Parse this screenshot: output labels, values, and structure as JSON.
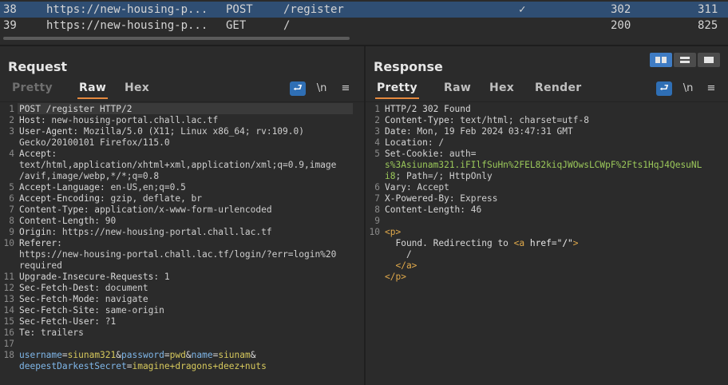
{
  "history": {
    "rows": [
      {
        "num": "38",
        "host": "https://new-housing-p...",
        "method": "POST",
        "path": "/register",
        "edited": "✓",
        "status": "302",
        "length": "311"
      },
      {
        "num": "39",
        "host": "https://new-housing-p...",
        "method": "GET",
        "path": "/",
        "edited": "",
        "status": "200",
        "length": "825"
      }
    ]
  },
  "request": {
    "title": "Request",
    "tabs": [
      "Pretty",
      "Raw",
      "Hex"
    ],
    "active_tab": "Raw",
    "wrap_icon": "⮐",
    "newline_toggle": "\\n",
    "menu_icon": "≡",
    "lines": [
      {
        "n": "1",
        "k": "POST /register HTTP/2",
        "v": ""
      },
      {
        "n": "2",
        "k": "Host",
        "v": ": new-housing-portal.chall.lac.tf"
      },
      {
        "n": "3",
        "k": "User-Agent",
        "v": ": Mozilla/5.0 (X11; Linux x86_64; rv:109.0)"
      },
      {
        "n": "",
        "k": "",
        "v": "Gecko/20100101 Firefox/115.0"
      },
      {
        "n": "4",
        "k": "Accept",
        "v": ":"
      },
      {
        "n": "",
        "k": "",
        "v": "text/html,application/xhtml+xml,application/xml;q=0.9,image"
      },
      {
        "n": "",
        "k": "",
        "v": "/avif,image/webp,*/*;q=0.8"
      },
      {
        "n": "5",
        "k": "Accept-Language",
        "v": ": en-US,en;q=0.5"
      },
      {
        "n": "6",
        "k": "Accept-Encoding",
        "v": ": gzip, deflate, br"
      },
      {
        "n": "7",
        "k": "Content-Type",
        "v": ": application/x-www-form-urlencoded"
      },
      {
        "n": "8",
        "k": "Content-Length",
        "v": ": 90"
      },
      {
        "n": "9",
        "k": "Origin",
        "v": ": https://new-housing-portal.chall.lac.tf"
      },
      {
        "n": "10",
        "k": "Referer",
        "v": ":"
      },
      {
        "n": "",
        "k": "",
        "v": "https://new-housing-portal.chall.lac.tf/login/?err=login%20"
      },
      {
        "n": "",
        "k": "",
        "v": "required"
      },
      {
        "n": "11",
        "k": "Upgrade-Insecure-Requests",
        "v": ": 1"
      },
      {
        "n": "12",
        "k": "Sec-Fetch-Dest",
        "v": ": document"
      },
      {
        "n": "13",
        "k": "Sec-Fetch-Mode",
        "v": ": navigate"
      },
      {
        "n": "14",
        "k": "Sec-Fetch-Site",
        "v": ": same-origin"
      },
      {
        "n": "15",
        "k": "Sec-Fetch-User",
        "v": ": ?1"
      },
      {
        "n": "16",
        "k": "Te",
        "v": ": trailers"
      },
      {
        "n": "17",
        "k": "",
        "v": ""
      }
    ],
    "body_line_no": "18",
    "body": [
      [
        {
          "t": "username",
          "c": "p-name"
        },
        {
          "t": "=",
          "c": "k"
        },
        {
          "t": "siunam321",
          "c": "p-val"
        },
        {
          "t": "&",
          "c": "k"
        },
        {
          "t": "password",
          "c": "p-name"
        },
        {
          "t": "=",
          "c": "k"
        },
        {
          "t": "pwd",
          "c": "p-val"
        },
        {
          "t": "&",
          "c": "k"
        },
        {
          "t": "name",
          "c": "p-name"
        },
        {
          "t": "=",
          "c": "k"
        },
        {
          "t": "siunam",
          "c": "p-val"
        },
        {
          "t": "&",
          "c": "k"
        }
      ],
      [
        {
          "t": "deepestDarkestSecret",
          "c": "p-name"
        },
        {
          "t": "=",
          "c": "k"
        },
        {
          "t": "imagine+dragons+deez+nuts",
          "c": "p-val"
        }
      ]
    ]
  },
  "response": {
    "title": "Response",
    "tabs": [
      "Pretty",
      "Raw",
      "Hex",
      "Render"
    ],
    "active_tab": "Pretty",
    "wrap_icon": "⮐",
    "newline_toggle": "\\n",
    "menu_icon": "≡",
    "lines": [
      {
        "n": "1",
        "k": "HTTP/2 302 Found",
        "v": ""
      },
      {
        "n": "2",
        "k": "Content-Type",
        "v": ": text/html; charset=utf-8"
      },
      {
        "n": "3",
        "k": "Date",
        "v": ": Mon, 19 Feb 2024 03:47:31 GMT"
      },
      {
        "n": "4",
        "k": "Location",
        "v": ": /"
      },
      {
        "n": "5",
        "k": "Set-Cookie",
        "v": ": auth="
      },
      {
        "n": "",
        "k": "",
        "v": "s%3Asiunam321.iFIlfSuHn%2FEL82kiqJWOwsLCWpF%2Fts1HqJ4QesuNL",
        "g": true
      },
      {
        "n": "",
        "k": "",
        "v": "i8; Path=/; HttpOnly",
        "split": "i8"
      },
      {
        "n": "6",
        "k": "Vary",
        "v": ": Accept"
      },
      {
        "n": "7",
        "k": "X-Powered-By",
        "v": ": Express"
      },
      {
        "n": "8",
        "k": "Content-Length",
        "v": ": 46"
      },
      {
        "n": "9",
        "k": "",
        "v": ""
      }
    ],
    "html_lines": [
      {
        "n": "10",
        "parts": [
          {
            "t": "<p>",
            "c": "tag"
          }
        ]
      },
      {
        "n": "",
        "parts": [
          {
            "t": "  Found. Redirecting to ",
            "c": "k"
          },
          {
            "t": "<a ",
            "c": "tag"
          },
          {
            "t": "href",
            "c": "attr"
          },
          {
            "t": "=",
            "c": "k"
          },
          {
            "t": "\"/\"",
            "c": "aval"
          },
          {
            "t": ">",
            "c": "tag"
          }
        ]
      },
      {
        "n": "",
        "parts": [
          {
            "t": "    /",
            "c": "k"
          }
        ]
      },
      {
        "n": "",
        "parts": [
          {
            "t": "  </a>",
            "c": "tag"
          }
        ]
      },
      {
        "n": "",
        "parts": [
          {
            "t": "</p>",
            "c": "tag"
          }
        ]
      }
    ]
  }
}
